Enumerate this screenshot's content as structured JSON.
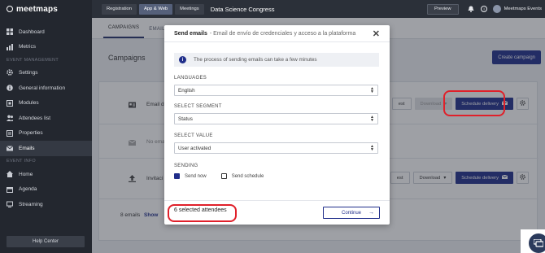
{
  "brand": {
    "name": "meetmaps"
  },
  "sidebar": {
    "items_top": [
      {
        "label": "Dashboard",
        "icon": "dashboard-icon"
      },
      {
        "label": "Metrics",
        "icon": "chart-icon"
      }
    ],
    "section_event": "EVENT MANAGEMENT",
    "items_event": [
      {
        "label": "Settings",
        "icon": "gear-icon"
      },
      {
        "label": "General information",
        "icon": "info-icon"
      },
      {
        "label": "Modules",
        "icon": "modules-icon"
      },
      {
        "label": "Attendees list",
        "icon": "users-icon"
      },
      {
        "label": "Properties",
        "icon": "properties-icon"
      },
      {
        "label": "Emails",
        "icon": "email-icon",
        "active": true
      }
    ],
    "section_info": "EVENT INFO",
    "items_info": [
      {
        "label": "Home",
        "icon": "home-icon"
      },
      {
        "label": "Agenda",
        "icon": "agenda-icon"
      },
      {
        "label": "Streaming",
        "icon": "streaming-icon"
      }
    ],
    "help_label": "Help Center"
  },
  "topbar": {
    "tabs": [
      "Registration",
      "App & Web",
      "Meetings"
    ],
    "active_tab": "App & Web",
    "event_name": "Data Science Congress",
    "preview_label": "Preview",
    "user_name": "Meetmaps Events"
  },
  "content": {
    "tabs": [
      "CAMPAIGNS",
      "EMAIL A"
    ],
    "title": "Campaigns",
    "create_label": "Create campaign",
    "row1_label": "Email d",
    "row1_test": "est",
    "row1_download": "Download",
    "row1_schedule": "Schedule delivery",
    "row2_label": "No emai",
    "row3_label": "Invitaci",
    "row3_test": "est",
    "row3_download": "Download",
    "row3_schedule": "Schedule delivery",
    "footer_count": "8 emails",
    "footer_show": "Show"
  },
  "modal": {
    "title": "Send emails",
    "subtitle": "- Email de envío de credenciales y acceso a la plataforma",
    "info_text": "The process of sending emails can take a few minutes",
    "languages_label": "LANGUAGES",
    "languages_value": "English",
    "segment_label": "SELECT SEGMENT",
    "segment_value": "Status",
    "value_label": "SELECT VALUE",
    "value_value": "User activated",
    "sending_label": "SENDING",
    "send_now": "Send now",
    "send_schedule": "Send schedule",
    "selected_attendees": "6 selected attendees",
    "continue_label": "Continue"
  },
  "colors": {
    "accent": "#202e8a",
    "highlight": "#e0202a"
  }
}
